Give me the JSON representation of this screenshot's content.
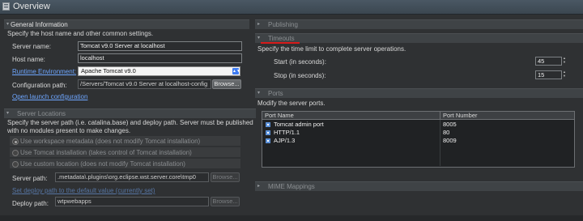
{
  "title": "Overview",
  "general": {
    "header": "General Information",
    "desc": "Specify the host name and other common settings.",
    "server_name_label": "Server name:",
    "server_name_value": "Tomcat v9.0 Server at localhost",
    "host_name_label": "Host name:",
    "host_name_value": "localhost",
    "runtime_label": "Runtime Environment:",
    "runtime_value": "Apache Tomcat v9.0",
    "config_label": "Configuration path:",
    "config_value": "/Servers/Tomcat v9.0 Server at localhost-config",
    "browse_label": "Browse...",
    "open_launch": "Open launch configuration"
  },
  "locations": {
    "header": "Server Locations",
    "desc_1": "Specify the server path (i.e. catalina.base) and deploy path. Server must be published",
    "desc_2": "with no modules present to make changes.",
    "options": [
      "Use workspace metadata (does not modify Tomcat installation)",
      "Use Tomcat installation (takes control of Tomcat installation)",
      "Use custom location (does not modify Tomcat installation)"
    ],
    "server_path_label": "Server path:",
    "server_path_value": ".metadata\\.plugins\\org.eclipse.wst.server.core\\tmp0",
    "browse_label": "Browse...",
    "set_default": "Set deploy path to the default value (currently set)",
    "deploy_label": "Deploy path:",
    "deploy_value": "wtpwebapps",
    "browse_label_2": "Browse..."
  },
  "publishing": {
    "header": "Publishing"
  },
  "timeouts": {
    "header": "Timeouts",
    "desc": "Specify the time limit to complete server operations.",
    "start_label": "Start (in seconds):",
    "start_value": "45",
    "stop_label": "Stop (in seconds):",
    "stop_value": "15"
  },
  "ports": {
    "header": "Ports",
    "desc": "Modify the server ports.",
    "columns": [
      "Port Name",
      "Port Number"
    ],
    "rows": [
      {
        "name": "Tomcat admin port",
        "number": "8005"
      },
      {
        "name": "HTTP/1.1",
        "number": "80"
      },
      {
        "name": "AJP/1.3",
        "number": "8009"
      }
    ]
  },
  "mime": {
    "header": "MIME Mappings"
  },
  "colors": {
    "accent": "#3d7bf2",
    "link": "#6ea6ff",
    "underline": "#d71a1a"
  }
}
